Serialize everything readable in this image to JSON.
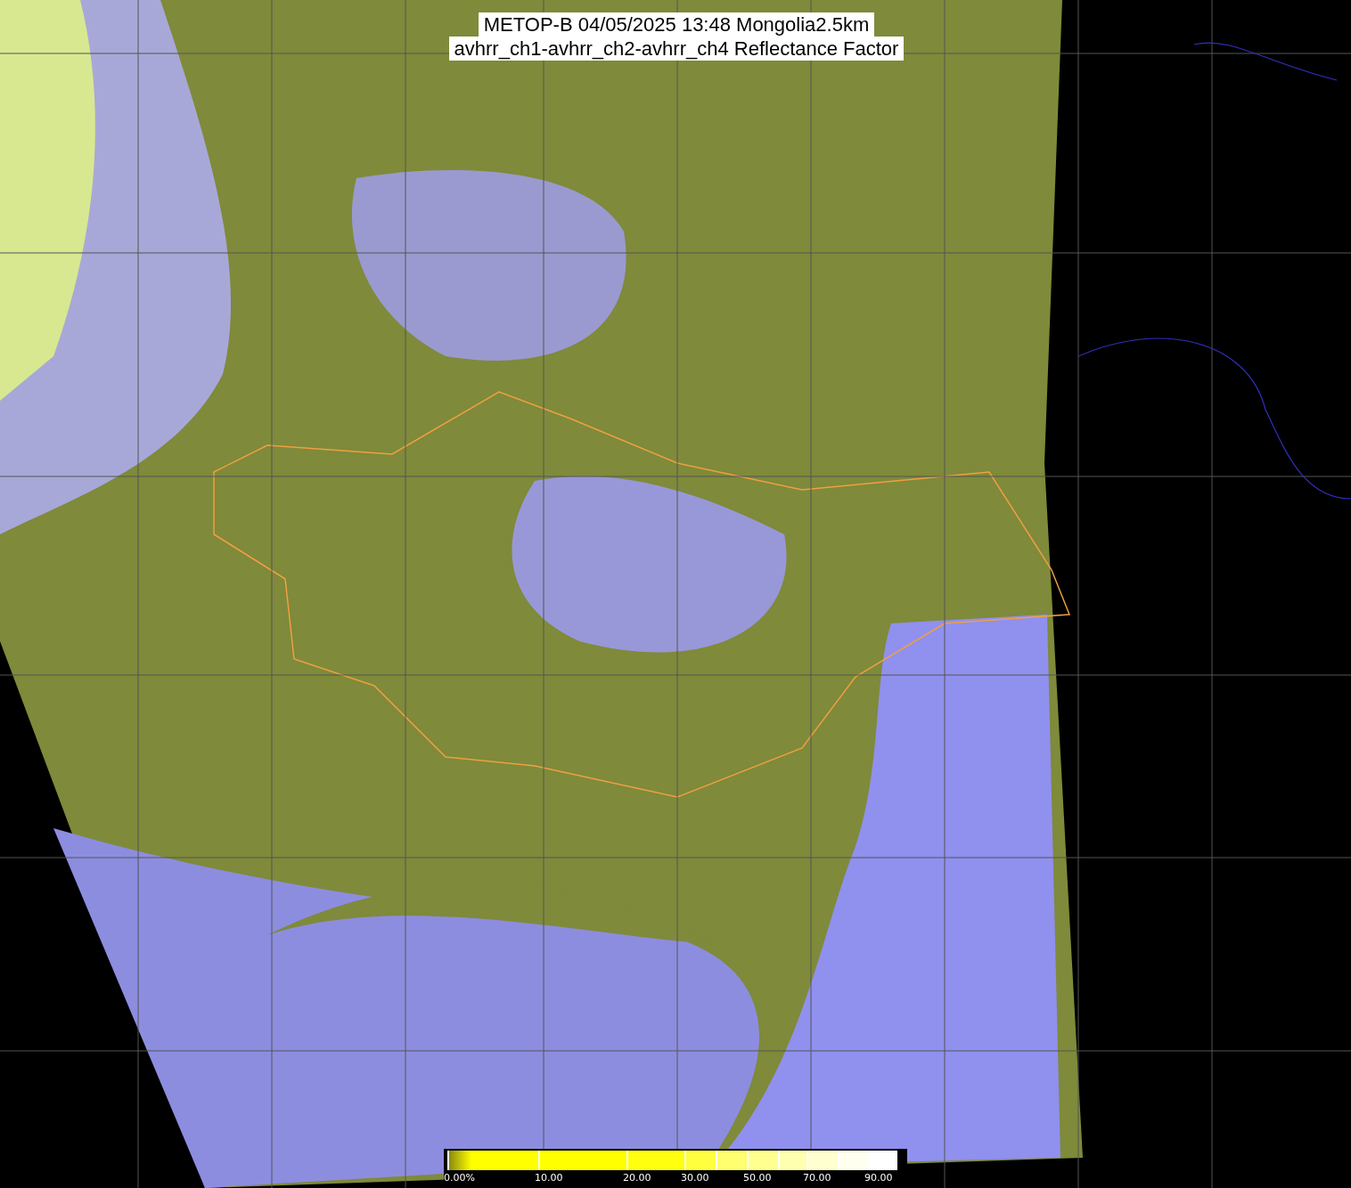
{
  "title": {
    "lines": [
      "METOP-B 04/05/2025 13:48 Mongolia2.5km",
      "avhrr_ch1-avhrr_ch2-avhrr_ch4 Reflectance Factor"
    ]
  },
  "colorbar": {
    "segments": [
      {
        "color": "#ffff00",
        "label": "0.00%"
      },
      {
        "color": "#ffff00",
        "label": "10.00"
      },
      {
        "color": "#ffff10",
        "label": "20.00"
      },
      {
        "color": "#ffff40",
        "label": "30.00"
      },
      {
        "color": "#ffff70"
      },
      {
        "color": "#ffff90",
        "label": "50.00"
      },
      {
        "color": "#ffffb0"
      },
      {
        "color": "#ffffd0",
        "label": "70.00"
      },
      {
        "color": "#fffff0"
      },
      {
        "color": "#ffffff",
        "label": "90.00"
      }
    ]
  }
}
